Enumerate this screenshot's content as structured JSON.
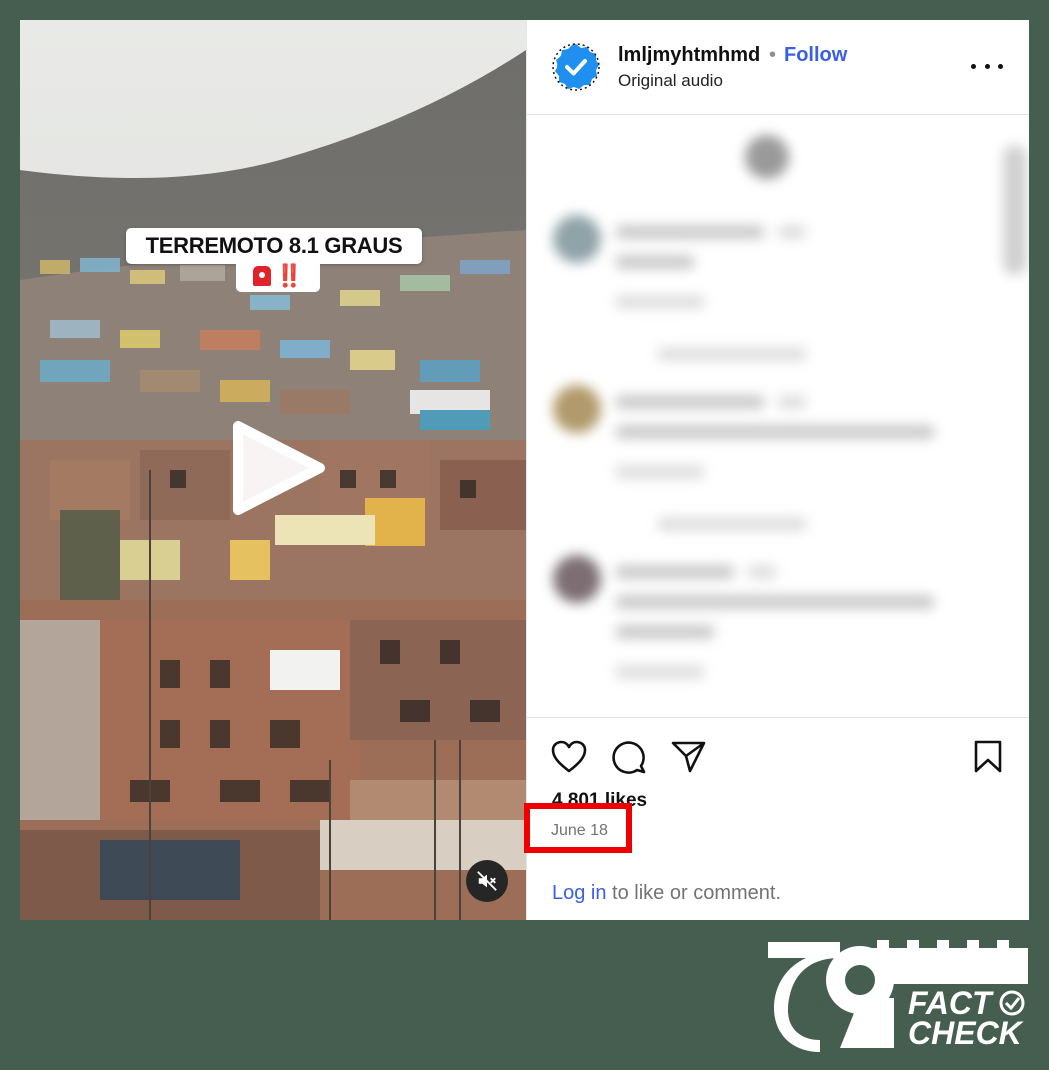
{
  "video": {
    "overlay_caption": "TERREMOTO 8.1 GRAUS",
    "overlay_marks": "‼️",
    "icons": [
      "play-icon",
      "mute-icon",
      "siren-emoji"
    ]
  },
  "post_header": {
    "username": "lmljmyhtmhmd",
    "separator": "•",
    "follow_label": "Follow",
    "audio_label": "Original audio",
    "icons": [
      "verified-avatar",
      "more-options-icon"
    ]
  },
  "engagement": {
    "likes": "4,801 likes",
    "date": "June 18",
    "login_link": "Log in",
    "login_suffix": " to like or comment.",
    "icons": [
      "heart-icon",
      "comment-icon",
      "share-icon",
      "bookmark-icon"
    ]
  },
  "branding": {
    "logo_text_top": "FACT",
    "logo_text_bottom": "CHECK",
    "logo_mark": "79"
  },
  "colors": {
    "frame_bg": "#455e4f",
    "accent_blue": "#3b5ee8",
    "highlight_red": "#ee0000",
    "verified_blue": "#1f8ff0"
  }
}
